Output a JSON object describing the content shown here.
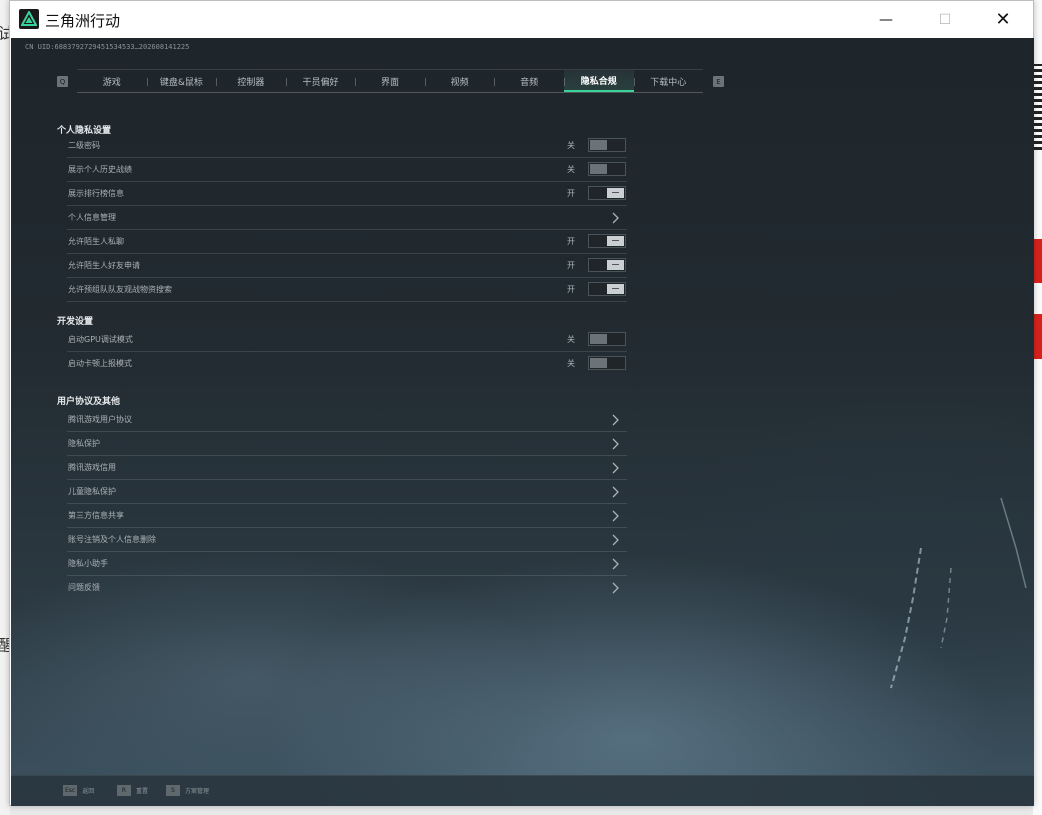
{
  "window": {
    "title": "三角洲行动",
    "minimize_glyph": "—",
    "maximize_glyph": "☐",
    "close_glyph": "✕"
  },
  "uid": "CN UID:6883792729451534533…202608141225",
  "tabs": {
    "prev_key": "Q",
    "next_key": "E",
    "items": [
      {
        "label": "游戏"
      },
      {
        "label": "键盘&鼠标"
      },
      {
        "label": "控制器"
      },
      {
        "label": "干员偏好"
      },
      {
        "label": "界面"
      },
      {
        "label": "视频"
      },
      {
        "label": "音频"
      },
      {
        "label": "隐私合规"
      },
      {
        "label": "下载中心"
      }
    ],
    "active_index": 7
  },
  "sections": {
    "personal_privacy": {
      "title": "个人隐私设置",
      "rows": [
        {
          "label": "二级密码",
          "type": "toggle",
          "state_text": "关",
          "on": false
        },
        {
          "label": "展示个人历史战绩",
          "type": "toggle",
          "state_text": "关",
          "on": false
        },
        {
          "label": "展示排行榜信息",
          "type": "toggle",
          "state_text": "开",
          "on": true
        },
        {
          "label": "个人信息管理",
          "type": "link"
        },
        {
          "label": "允许陌生人私聊",
          "type": "toggle",
          "state_text": "开",
          "on": true
        },
        {
          "label": "允许陌生人好友申请",
          "type": "toggle",
          "state_text": "开",
          "on": true
        },
        {
          "label": "允许预组队队友观战物资搜索",
          "type": "toggle",
          "state_text": "开",
          "on": true
        }
      ]
    },
    "developer": {
      "title": "开发设置",
      "rows": [
        {
          "label": "启动GPU调试模式",
          "type": "toggle",
          "state_text": "关",
          "on": false
        },
        {
          "label": "启动卡顿上报模式",
          "type": "toggle",
          "state_text": "关",
          "on": false
        }
      ]
    },
    "agreements": {
      "title": "用户协议及其他",
      "rows": [
        {
          "label": "腾讯游戏用户协议",
          "type": "link"
        },
        {
          "label": "隐私保护",
          "type": "link"
        },
        {
          "label": "腾讯游戏信用",
          "type": "link"
        },
        {
          "label": "儿童隐私保护",
          "type": "link"
        },
        {
          "label": "第三方信息共享",
          "type": "link"
        },
        {
          "label": "账号注销及个人信息删除",
          "type": "link"
        },
        {
          "label": "隐私小助手",
          "type": "link"
        },
        {
          "label": "问题反馈",
          "type": "link"
        }
      ]
    }
  },
  "bottom_hints": [
    {
      "key": "Esc",
      "label": "返回"
    },
    {
      "key": "R",
      "label": "重置"
    },
    {
      "key": "S",
      "label": "方案管理"
    }
  ],
  "desktop": {
    "left_chars": [
      "试",
      "醒"
    ]
  },
  "colors": {
    "accent": "#3bd39a",
    "client_bg": "#222b31",
    "desktop_red": "#d9221c"
  },
  "icons": {
    "app": "delta-force-logo-icon",
    "link_row": "chevron-right-icon"
  }
}
